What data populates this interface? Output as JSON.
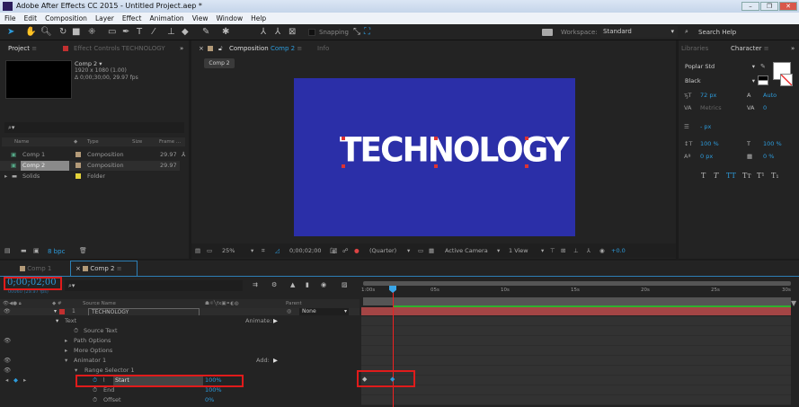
{
  "app": {
    "title": "Adobe After Effects CC 2015 - Untitled Project.aep *",
    "logo": "Ae"
  },
  "menu": [
    "File",
    "Edit",
    "Composition",
    "Layer",
    "Effect",
    "Animation",
    "View",
    "Window",
    "Help"
  ],
  "toolbar": {
    "snapping": "Snapping",
    "workspace_label": "Workspace:",
    "workspace_value": "Standard",
    "search_help": "Search Help"
  },
  "project_panel": {
    "tab": "Project",
    "effect_tab": "Effect Controls TECHNOLOGY",
    "preview": {
      "name": "Comp 2 ▾",
      "size": "1920 x 1080 (1.00)",
      "duration": "Δ 0;00;30;00, 29.97 fps"
    },
    "columns": [
      "Name",
      "Type",
      "Size",
      "Frame ..."
    ],
    "items": [
      {
        "name": "Comp 1",
        "type": "Composition",
        "fps": "29.97",
        "color": "#b39a78"
      },
      {
        "name": "Comp 2",
        "type": "Composition",
        "fps": "29.97",
        "color": "#b39a78"
      },
      {
        "name": "Solids",
        "type": "Folder",
        "fps": "",
        "color": "#e3d23a"
      }
    ],
    "bpc": "8 bpc"
  },
  "comp_panel": {
    "tab_label": "Composition",
    "tab_comp": "Comp 2",
    "info_tab": "Info",
    "sub_tab": "Comp 2",
    "text": "TECHNOLOGY",
    "bg_color": "#2b2fa8",
    "zoom": "25%",
    "timecode": "0;00;02;00",
    "resolution": "(Quarter)",
    "camera": "Active Camera",
    "views": "1 View",
    "exposure": "+0.0"
  },
  "character_panel": {
    "libraries_tab": "Libraries",
    "tab": "Character",
    "font": "Poplar Std",
    "style": "Black",
    "size": "72 px",
    "leading": "Auto",
    "kerning": "Metrics",
    "tracking": "0",
    "stroke": "- px",
    "vscale": "100 %",
    "hscale": "100 %",
    "baseline": "0 px",
    "tsume": "0 %",
    "styles": [
      "T",
      "T",
      "TT",
      "Tт",
      "T¹",
      "T₁"
    ]
  },
  "timeline": {
    "tabs": [
      "Comp 1",
      "Comp 2"
    ],
    "timecode": "0;00;02;00",
    "frame_info": "00060 (29.97 fps)",
    "headers": {
      "source": "Source Name",
      "parent": "Parent"
    },
    "layer": {
      "num": "1",
      "name": "TECHNOLOGY",
      "parent": "None"
    },
    "rows": [
      {
        "label": "Text",
        "right": "Animate:"
      },
      {
        "label": "Source Text"
      },
      {
        "label": "Path Options"
      },
      {
        "label": "More Options"
      },
      {
        "label": "Animator 1",
        "right": "Add:"
      },
      {
        "label": "Range Selector 1"
      },
      {
        "label": "Start",
        "value": "100%"
      },
      {
        "label": "End",
        "value": "100%"
      },
      {
        "label": "Offset",
        "value": "0%"
      }
    ],
    "ruler": [
      "1:00s",
      "05s",
      "10s",
      "15s",
      "20s",
      "25s",
      "30s"
    ]
  }
}
